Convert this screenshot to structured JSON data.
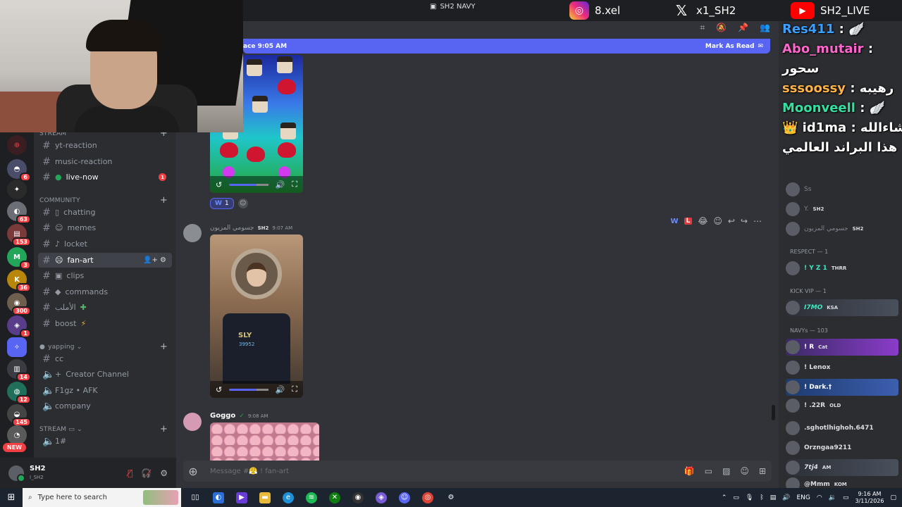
{
  "stream": {
    "title": "SH2 NAVY",
    "instagram": "8.xel",
    "x": "x1_SH2",
    "youtube": "SH2_LIVE"
  },
  "servers": [
    {
      "badge": ""
    },
    {
      "badge": "6"
    },
    {
      "badge": ""
    },
    {
      "badge": "63"
    },
    {
      "badge": "153"
    },
    {
      "badge": "3"
    },
    {
      "badge": "36"
    },
    {
      "badge": "300"
    },
    {
      "badge": "1"
    },
    {
      "badge": ""
    },
    {
      "badge": "14"
    },
    {
      "badge": "12"
    },
    {
      "badge": "145"
    }
  ],
  "new_label": "NEW",
  "channels": {
    "cat_stream_top": "STREAM",
    "yt_reaction": "yt-reaction",
    "music_reaction": "music-reaction",
    "live_now": "live-now",
    "live_now_badge": "1",
    "cat_community": "COMMUNITY",
    "chatting": "chatting",
    "memes": "memes",
    "locket": "locket",
    "fan_art": "fan-art",
    "clips": "clips",
    "commands": "commands",
    "alamuu": "الأملب",
    "boost": "boost",
    "cat_yapping": "yapping",
    "cc": "cc",
    "creator_channel": "Creator Channel",
    "f1gz": "F1gz • AFK",
    "company": "company",
    "cat_stream": "STREAM",
    "one_hash": "1#"
  },
  "user": {
    "name": "SH2",
    "sub": "I_SH2"
  },
  "chat": {
    "new_messages": "ace 9:05 AM",
    "mark_read": "Mark As Read",
    "reaction_emoji": "W",
    "reaction_count": "1",
    "msg2_author": "جسومي المزيون",
    "msg2_tag": "SH2",
    "msg2_time": "9:07 AM",
    "shirt_text": "SLY",
    "shirt_num": "39952",
    "msg3_author": "Goggo",
    "msg3_time": "9:08 AM",
    "composer_placeholder": "Message #😤 ! fan-art"
  },
  "overlay_chat": [
    {
      "user": "Res411",
      "color": "#3aa0ff",
      "sep": " :",
      "msg": " 🪽"
    },
    {
      "user": "Abo_mutair",
      "color": "#ff66cc",
      "sep": " :",
      "msg": ""
    },
    {
      "user": "",
      "color": "#ffffff",
      "sep": "",
      "msg": "سحور"
    },
    {
      "user": "sssoossy",
      "color": "#ffb347",
      "sep": " :",
      "msg": " رهيبه"
    },
    {
      "user": "Moonveell",
      "color": "#33e0a0",
      "sep": " :",
      "msg": " 🪽"
    },
    {
      "user": "👑 id1ma",
      "color": "#ffffff",
      "sep": " :",
      "msg": " ماشاءالله"
    },
    {
      "user": "",
      "color": "#ffffff",
      "sep": "",
      "msg": "هذا البراند العالمي"
    }
  ],
  "members": {
    "m_ss": "Ss",
    "m_y": "Y.",
    "m_y_tag": "SH2",
    "m_jasumi": "جسومي المزيون",
    "m_jasumi_tag": "SH2",
    "cat_respect": "RESPECT — 1",
    "m_yz1": "! Y Z 1",
    "m_yz1_tag": "THRR",
    "cat_kick": "KICK VIP — 1",
    "m_17mo": "I7MO",
    "m_17mo_tag": "KSA",
    "cat_navys": "NAVYs — 103",
    "m_r": "! R",
    "m_r_tag": "Cat",
    "m_lenox": "! Lenox",
    "m_dark": "! Dark.†",
    "m_22r": "! .22R",
    "m_22r_tag": "OLD",
    "m_sghot": ".sghotlhighoh.6471",
    "m_orz": "Orzngaa9211",
    "m_7tj4": "7tj4",
    "m_7tj4_tag": "AM",
    "m_mmm": "@Mmm",
    "m_mmm_tag": "KOM"
  },
  "taskbar": {
    "search": "Type here to search",
    "lang": "ENG",
    "time": "9:16 AM",
    "date": "3/11/2026"
  }
}
